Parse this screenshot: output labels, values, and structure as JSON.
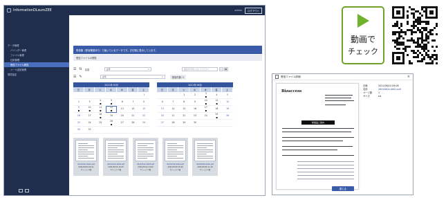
{
  "app": {
    "title": "InformationDLsumZEE",
    "user_label": "admin",
    "logout_label": "ログアウト"
  },
  "sidebar": {
    "items": [
      {
        "label": "データ管理"
      },
      {
        "label": "バインダー管理"
      },
      {
        "label": "ファイル管理"
      },
      {
        "label": "仕訳管理"
      },
      {
        "label": "受信ファイル閲覧"
      },
      {
        "label": "メール送信管理"
      },
      {
        "label": "環境設定"
      }
    ]
  },
  "main": {
    "banner": "受信箱（受信確認待ち）で届いているデータです。日付順に表示しています。",
    "subhead": "受信ファイルの閲覧",
    "filter_label": "名前",
    "filter_select": "全件",
    "search_placeholder": "検索文字列を入力してください",
    "count_label": "受信件数: 5",
    "prev_label": "‹",
    "next_label": "›"
  },
  "calendars": [
    {
      "title": "2021年 05月",
      "dow": [
        "日",
        "月",
        "火",
        "水",
        "木",
        "金",
        "土"
      ],
      "cells": [
        "",
        "",
        "",
        "",
        "",
        "",
        "1",
        "2",
        "3",
        "4",
        "5",
        "6",
        "7",
        "8",
        "9",
        "10",
        "11",
        "12",
        "13",
        "14",
        "15",
        "16",
        "17",
        "18",
        "19",
        "20",
        "21",
        "22",
        "23",
        "24",
        "25",
        "26",
        "27",
        "28",
        "29",
        "30",
        "31",
        "",
        "",
        "",
        "",
        ""
      ],
      "marks": [
        4,
        5,
        9,
        10,
        11,
        12,
        18,
        26
      ]
    },
    {
      "title": "2021年 06月",
      "dow": [
        "日",
        "月",
        "火",
        "水",
        "木",
        "金",
        "土"
      ],
      "cells": [
        "",
        "",
        "1",
        "2",
        "3",
        "4",
        "5",
        "6",
        "7",
        "8",
        "9",
        "10",
        "11",
        "12",
        "13",
        "14",
        "15",
        "16",
        "17",
        "18",
        "19",
        "20",
        "21",
        "22",
        "23",
        "24",
        "25",
        "26",
        "27",
        "28",
        "29",
        "30",
        "",
        "",
        ""
      ],
      "marks": [
        3,
        10,
        11,
        17,
        25
      ]
    }
  ],
  "thumbs": [
    {
      "name": "20210504-0001.pdf",
      "date": "2021/05/04 09:11",
      "pages": "1ページ | 1枚"
    },
    {
      "name": "20210510-0002.pdf",
      "date": "2021/05/10 10:25",
      "pages": "1ページ | 1枚"
    },
    {
      "name": "20210512-0003.pdf",
      "date": "2021/05/12 13:02",
      "pages": "1ページ | 1枚"
    },
    {
      "name": "20210518-0004.pdf",
      "date": "2021/05/18 15:40",
      "pages": "1ページ | 1枚"
    },
    {
      "name": "20210526-0005.pdf",
      "date": "2021/05/26 11:18",
      "pages": "1ページ | 1枚"
    }
  ],
  "pager": [
    "«",
    "»"
  ],
  "video_badge": {
    "line1": "動画で",
    "line2": "チェック",
    "accent": "#6fb22b"
  },
  "dialog": {
    "title": "受信ファイル詳細",
    "doc_logo": "Bizaccess",
    "doc_heading": "新製品ご案内",
    "meta": [
      {
        "k": "日時",
        "v": "2021/06/24 09:08",
        "link": false
      },
      {
        "k": "名前",
        "v": "20210624-0001.pdf",
        "link": true
      },
      {
        "k": "ページ数",
        "v": "1",
        "link": false
      },
      {
        "k": "サイズ",
        "v": "A4",
        "link": false
      }
    ],
    "close_label": "閉じる"
  },
  "colors": {
    "navy": "#1f2e4c",
    "accent_blue": "#3a5ca8",
    "active_item": "#4a6fbe",
    "badge_green": "#6fa329"
  }
}
